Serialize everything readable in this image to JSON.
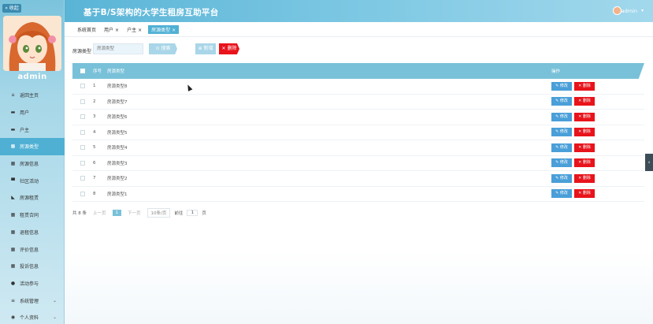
{
  "sidebar": {
    "collapse_label": "« 收起",
    "admin_name": "admin",
    "items": [
      {
        "label": "返回主页",
        "icon": "home-icon",
        "glyph": "⌂"
      },
      {
        "label": "用户",
        "icon": "id-card-icon",
        "glyph": "▬"
      },
      {
        "label": "户主",
        "icon": "id-card-icon",
        "glyph": "▬"
      },
      {
        "label": "房源类型",
        "icon": "grid-icon",
        "glyph": "▦"
      },
      {
        "label": "房源信息",
        "icon": "grid-icon",
        "glyph": "▦"
      },
      {
        "label": "社区活动",
        "icon": "monitor-icon",
        "glyph": "▀"
      },
      {
        "label": "房源租赁",
        "icon": "tag-icon",
        "glyph": "◣"
      },
      {
        "label": "租赁合同",
        "icon": "grid-icon",
        "glyph": "▦"
      },
      {
        "label": "退租信息",
        "icon": "grid-icon",
        "glyph": "▦"
      },
      {
        "label": "评价信息",
        "icon": "grid-icon",
        "glyph": "▦"
      },
      {
        "label": "投诉信息",
        "icon": "grid-icon",
        "glyph": "▦"
      },
      {
        "label": "活动参与",
        "icon": "location-icon",
        "glyph": "●"
      },
      {
        "label": "系统管理",
        "icon": "list-icon",
        "glyph": "≡"
      },
      {
        "label": "个人资料",
        "icon": "user-icon",
        "glyph": "◉"
      }
    ]
  },
  "header": {
    "title": "基于B/S架构的大学生租房互助平台",
    "user": "admin"
  },
  "tabs": [
    {
      "label": "系统首页",
      "closable": false
    },
    {
      "label": "用户",
      "closable": true
    },
    {
      "label": "户主",
      "closable": true
    },
    {
      "label": "房源类型",
      "closable": true
    }
  ],
  "search": {
    "label": "房源类型",
    "placeholder": "房源类型",
    "search_button": "⊙ 搜索",
    "add_button": "⊕ 新增",
    "delete_button": "✕ 删除"
  },
  "table": {
    "headers": {
      "index": "序号",
      "name": "房源类型",
      "actions": "操作"
    },
    "edit_label": "✎ 修改",
    "delete_label": "✕ 删除",
    "rows": [
      {
        "index": "1",
        "name": "房源类型8"
      },
      {
        "index": "2",
        "name": "房源类型7"
      },
      {
        "index": "3",
        "name": "房源类型6"
      },
      {
        "index": "4",
        "name": "房源类型5"
      },
      {
        "index": "5",
        "name": "房源类型4"
      },
      {
        "index": "6",
        "name": "房源类型3"
      },
      {
        "index": "7",
        "name": "房源类型2"
      },
      {
        "index": "8",
        "name": "房源类型1"
      }
    ]
  },
  "pager": {
    "total": "共 8 条",
    "prev": "上一页",
    "current": "1",
    "next": "下一页",
    "page_size": "10条/页",
    "goto_label": "前往",
    "goto_value": "1",
    "page_unit": "页"
  },
  "colors": {
    "accent": "#79c1d9",
    "active_menu": "#4fb0d4",
    "danger": "#e8131b",
    "edit": "#4a9fd8"
  }
}
